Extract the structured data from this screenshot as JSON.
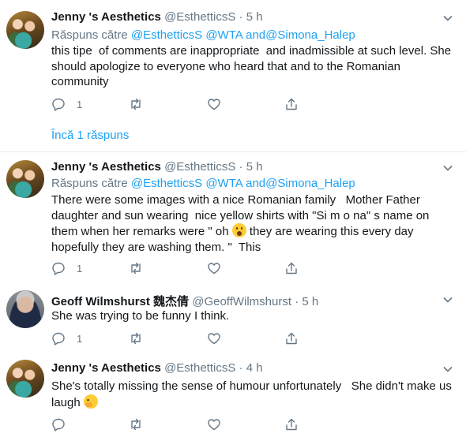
{
  "tweets": [
    {
      "name": "Jenny 's Aesthetics",
      "handle": "@EsthetticsS",
      "dot": "·",
      "time": "5 h",
      "reply_prefix": "Răspuns către",
      "reply_m1": "@EsthetticsS",
      "reply_m2": "@WTA",
      "reply_and": "and",
      "reply_m3": "@Simona_Halep",
      "text": "this tipe  of comments are inappropriate  and inadmissible at such level. She should apologize to everyone who heard that and to the Romanian community",
      "reply_count": "1",
      "retweet_count": "",
      "like_count": "",
      "more_replies": "Încă 1 răspuns"
    },
    {
      "name": "Jenny 's Aesthetics",
      "handle": "@EsthetticsS",
      "dot": "·",
      "time": "5 h",
      "reply_prefix": "Răspuns către",
      "reply_m1": "@EsthetticsS",
      "reply_m2": "@WTA",
      "reply_and": "and",
      "reply_m3": "@Simona_Halep",
      "text_a": "There were some images with a nice Romanian family   Mother Father daughter and sun wearing  nice yellow shirts with \"Si m o na\" s name on them when her remarks were \" oh ",
      "emoji_a": "astonished-face-emoji",
      "text_b": " they are wearing this every day hopefully they are washing them. \"  This",
      "reply_count": "1",
      "retweet_count": "",
      "like_count": ""
    },
    {
      "name": "Geoff Wilmshurst 魏杰倩",
      "handle": "@GeoffWilmshurst",
      "dot": "·",
      "time": "5 h",
      "text": "She was trying to be funny I think.",
      "reply_count": "1",
      "retweet_count": "",
      "like_count": ""
    },
    {
      "name": "Jenny 's Aesthetics",
      "handle": "@EsthetticsS",
      "dot": "·",
      "time": "4 h",
      "text_a": "She's totally missing the sense of humour unfortunately   She didn't make us laugh ",
      "emoji_a": "face-with-hand-over-mouth-emoji",
      "reply_count": "",
      "retweet_count": "",
      "like_count": ""
    }
  ],
  "colors": {
    "accent": "#1da1f2",
    "muted": "#657786",
    "text": "#14171a",
    "divider": "#e6ecf0"
  }
}
